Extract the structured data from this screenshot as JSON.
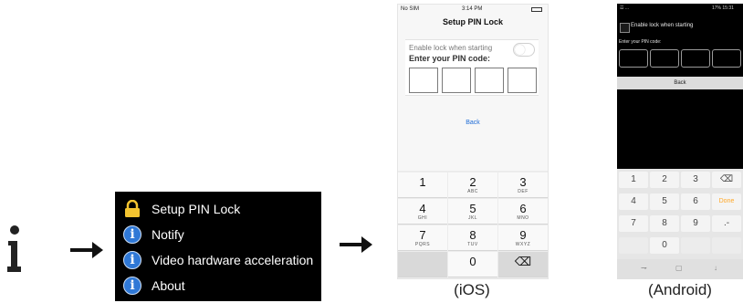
{
  "colors": {
    "menu_bg": "#000000",
    "info_blue": "#2f78d6",
    "lock_yellow": "#f4c430",
    "ios_link": "#1d6bd6",
    "android_done": "#ffa726"
  },
  "menu": {
    "items": [
      {
        "icon": "lock-icon",
        "label": "Setup PIN Lock"
      },
      {
        "icon": "info-icon",
        "label": "Notify"
      },
      {
        "icon": "info-icon",
        "label": "Video hardware acceleration"
      },
      {
        "icon": "info-icon",
        "label": "About"
      }
    ]
  },
  "ios": {
    "status": {
      "carrier": "No SIM",
      "time": "3:14 PM"
    },
    "title": "Setup PIN Lock",
    "enable_label": "Enable lock when starting",
    "enable_on": false,
    "enter_label": "Enter your PIN code:",
    "back_label": "Back",
    "keys": [
      {
        "d": "1",
        "l": ""
      },
      {
        "d": "2",
        "l": "ABC"
      },
      {
        "d": "3",
        "l": "DEF"
      },
      {
        "d": "4",
        "l": "GHI"
      },
      {
        "d": "5",
        "l": "JKL"
      },
      {
        "d": "6",
        "l": "MNO"
      },
      {
        "d": "7",
        "l": "PQRS"
      },
      {
        "d": "8",
        "l": "TUV"
      },
      {
        "d": "9",
        "l": "WXYZ"
      },
      {
        "d": "",
        "l": ""
      },
      {
        "d": "0",
        "l": ""
      },
      {
        "d": "⌫",
        "l": ""
      }
    ],
    "caption": "(iOS)"
  },
  "android": {
    "status": {
      "left": "☲ ...",
      "right": "17% 15:31"
    },
    "enable_label": "Enable lock when starting",
    "enter_label": "Enter your PIN code:",
    "back_label": "Back",
    "keys": [
      "1",
      "2",
      "3",
      "⌫",
      "4",
      "5",
      "6",
      "Done",
      "7",
      "8",
      "9",
      ".-",
      "",
      "0",
      "",
      ""
    ],
    "caption": "(Android)"
  }
}
